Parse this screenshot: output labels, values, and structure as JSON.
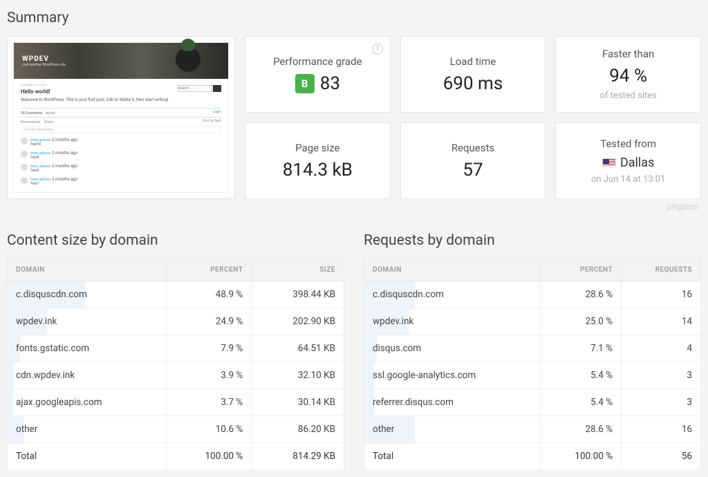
{
  "summary_title": "Summary",
  "brand": "pingdom",
  "screenshot": {
    "site_name": "WPDEV",
    "tagline": "Just another WordPress site",
    "post_title": "Hello world!",
    "post_excerpt": "Welcome to WordPress. This is your first post. Edit or delete it, then start writing!",
    "search_placeholder": "Search …",
    "comments_count": "30 Comments",
    "comments_site": "wpdev",
    "login": "Login",
    "tab_recommend": "Recommend",
    "tab_share": "Share",
    "sort": "Sort by Best",
    "join_placeholder": "Join the discussion…",
    "comment_author": "brian jackson",
    "comment_time": "2 months ago",
    "comment_text1": "Test10",
    "comment_text2": "Test8",
    "comment_text3": "Test9",
    "comment_text4": "Test7"
  },
  "cards": {
    "grade_label": "Performance grade",
    "grade_letter": "B",
    "grade_value": "83",
    "load_label": "Load time",
    "load_value": "690 ms",
    "faster_label": "Faster than",
    "faster_value": "94 %",
    "faster_sub": "of tested sites",
    "size_label": "Page size",
    "size_value": "814.3 kB",
    "requests_label": "Requests",
    "requests_value": "57",
    "tested_label": "Tested from",
    "tested_location": "Dallas",
    "tested_time": "on Jun 14 at 13:01"
  },
  "content_size": {
    "title": "Content size by domain",
    "col_domain": "DOMAIN",
    "col_percent": "PERCENT",
    "col_size": "SIZE",
    "rows": [
      {
        "domain": "c.disquscdn.com",
        "percent": "48.9 %",
        "pct": 48.9,
        "size": "398.44 KB"
      },
      {
        "domain": "wpdev.ink",
        "percent": "24.9 %",
        "pct": 24.9,
        "size": "202.90 KB"
      },
      {
        "domain": "fonts.gstatic.com",
        "percent": "7.9 %",
        "pct": 7.9,
        "size": "64.51 KB"
      },
      {
        "domain": "cdn.wpdev.ink",
        "percent": "3.9 %",
        "pct": 3.9,
        "size": "32.10 KB"
      },
      {
        "domain": "ajax.googleapis.com",
        "percent": "3.7 %",
        "pct": 3.7,
        "size": "30.14 KB"
      },
      {
        "domain": "other",
        "percent": "10.6 %",
        "pct": 10.6,
        "size": "86.20 KB"
      }
    ],
    "total_label": "Total",
    "total_percent": "100.00 %",
    "total_size": "814.29 KB"
  },
  "requests_by": {
    "title": "Requests by domain",
    "col_domain": "DOMAIN",
    "col_percent": "PERCENT",
    "col_req": "REQUESTS",
    "rows": [
      {
        "domain": "c.disquscdn.com",
        "percent": "28.6 %",
        "pct": 28.6,
        "req": "16"
      },
      {
        "domain": "wpdev.ink",
        "percent": "25.0 %",
        "pct": 25.0,
        "req": "14"
      },
      {
        "domain": "disqus.com",
        "percent": "7.1 %",
        "pct": 7.1,
        "req": "4"
      },
      {
        "domain": "ssl.google-analytics.com",
        "percent": "5.4 %",
        "pct": 5.4,
        "req": "3"
      },
      {
        "domain": "referrer.disqus.com",
        "percent": "5.4 %",
        "pct": 5.4,
        "req": "3"
      },
      {
        "domain": "other",
        "percent": "28.6 %",
        "pct": 28.6,
        "req": "16"
      }
    ],
    "total_label": "Total",
    "total_percent": "100.00 %",
    "total_req": "56"
  }
}
